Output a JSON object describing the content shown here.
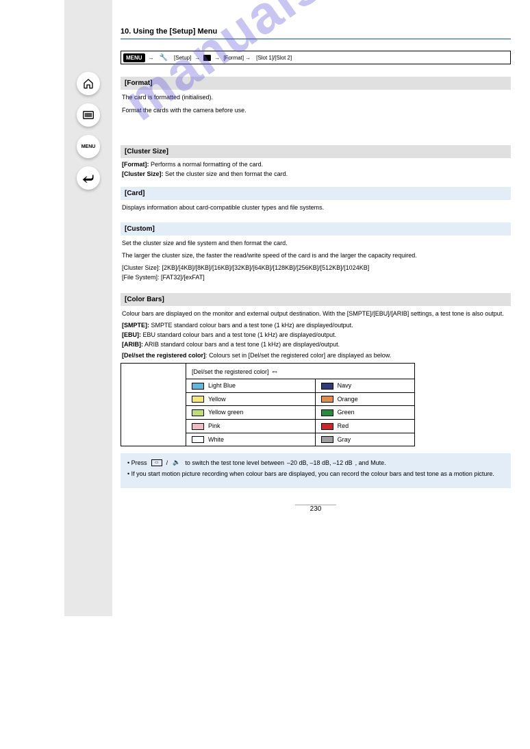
{
  "watermark": "manualshive.com",
  "sidebarIcons": [
    "home-icon",
    "list-icon",
    "menu-icon",
    "back-icon"
  ],
  "header": {
    "sectionLabel": "10.",
    "sectionTitle": "Using the [Setup] Menu",
    "menuWord": "MENU",
    "setupWord": "[Setup]",
    "bracketLabel": "[Format]",
    "cardOption": "[Slot 1]/[Slot 2]"
  },
  "format": {
    "title": "[Format]",
    "desc1": "The card is formatted (initialised).",
    "desc2": "Format the cards with the camera before use."
  },
  "cluster": {
    "title": "[Cluster Size]",
    "formatSub": {
      "label": "[Format]:",
      "text": "Performs a normal formatting of the card."
    },
    "sizeSub": {
      "label": "[Cluster Size]:",
      "text": "Set the cluster size and then format the card."
    },
    "cardHead": "[Card]",
    "cardBody": "Displays information about card-compatible cluster types and file systems.",
    "custHead": "[Custom]",
    "custBody1": "Set the cluster size and file system and then format the card.",
    "custBody2": "The larger the cluster size, the faster the read/write speed of the card is and the larger the capacity required.",
    "clusterList": "[Cluster Size]: [2KB]/[4KB]/[8KB]/[16KB]/[32KB]/[64KB]/[128KB]/[256KB]/[512KB]/[1024KB]",
    "fsList": "[File System]: [FAT32]/[exFAT]"
  },
  "color": {
    "title": "[Color Bars]",
    "desc": "Colour bars are displayed on the monitor and external output destination. With the [SMPTE]/[EBU]/[ARIB] settings, a test tone is also output.",
    "smpte": {
      "label": "[SMPTE]:",
      "text": "SMPTE standard colour bars and a test tone (1 kHz) are displayed/output."
    },
    "ebu": {
      "label": "[EBU]:",
      "text": "EBU standard colour bars and a test tone (1 kHz) are displayed/output."
    },
    "arib": {
      "label": "[ARIB]:",
      "text": "ARIB standard colour bars and a test tone (1 kHz) are displayed/output."
    },
    "delRow": {
      "prefix": "Colours set in",
      "link": "[Del/set the registered color]",
      "suffix": "are displayed as below."
    },
    "thHeader": "[Del/set the registered color]",
    "rows": [
      {
        "l": {
          "cls": "c-lblue",
          "name": "Light Blue"
        },
        "r": {
          "cls": "c-navy",
          "name": "Navy"
        }
      },
      {
        "l": {
          "cls": "c-yellow",
          "name": "Yellow"
        },
        "r": {
          "cls": "c-orange",
          "name": "Orange"
        }
      },
      {
        "l": {
          "cls": "c-ygreen",
          "name": "Yellow green"
        },
        "r": {
          "cls": "c-green",
          "name": "Green"
        }
      },
      {
        "l": {
          "cls": "c-pink",
          "name": "Pink"
        },
        "r": {
          "cls": "c-red",
          "name": "Red"
        }
      },
      {
        "l": {
          "cls": "c-white",
          "name": "White"
        },
        "r": {
          "cls": "c-gray",
          "name": "Gray"
        }
      }
    ]
  },
  "note": {
    "line1a": "• Press ",
    "toggle": "TOGGLE",
    "line1b": "/",
    "line1c": " to switch the test tone level between ",
    "levels": "–20 dB, –18 dB, –12 dB",
    "line1d": ", and Mute.",
    "line2": "• If you start motion picture recording when colour bars are displayed, you can record the colour bars and test tone as a motion picture."
  },
  "pageNumber": "230"
}
